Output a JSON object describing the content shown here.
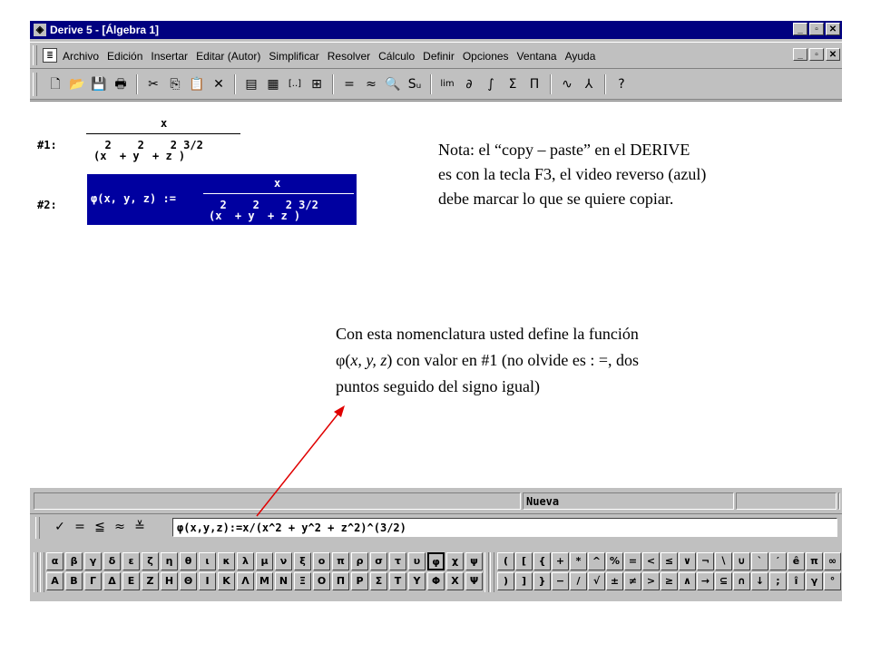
{
  "window": {
    "title": "Derive 5 - [Álgebra 1]",
    "app_icon": "◈",
    "buttons": [
      "_",
      "▫",
      "✕"
    ]
  },
  "menu": {
    "doc_icon": "≣",
    "items": [
      "Archivo",
      "Edición",
      "Insertar",
      "Editar (Autor)",
      "Simplificar",
      "Resolver",
      "Cálculo",
      "Definir",
      "Opciones",
      "Ventana",
      "Ayuda"
    ],
    "mdi_buttons": [
      "_",
      "▫",
      "✕"
    ]
  },
  "toolbar": {
    "icons": [
      {
        "name": "new-doc-icon",
        "glyph": "🗋"
      },
      {
        "name": "open-folder-icon",
        "glyph": "📂"
      },
      {
        "name": "save-icon",
        "glyph": "💾"
      },
      {
        "name": "print-icon",
        "glyph": "🖶"
      },
      {
        "name": "sep"
      },
      {
        "name": "cut-icon",
        "glyph": "✂"
      },
      {
        "name": "copy-icon",
        "glyph": "⎘"
      },
      {
        "name": "paste-icon",
        "glyph": "📋"
      },
      {
        "name": "delete-icon",
        "glyph": "✕"
      },
      {
        "name": "sep"
      },
      {
        "name": "text-object-icon",
        "glyph": "▤"
      },
      {
        "name": "edit-object-icon",
        "glyph": "▦"
      },
      {
        "name": "vector-icon",
        "glyph": "[..]"
      },
      {
        "name": "matrix-icon",
        "glyph": "⊞"
      },
      {
        "name": "sep"
      },
      {
        "name": "simplify-icon",
        "glyph": "="
      },
      {
        "name": "approximate-icon",
        "glyph": "≈"
      },
      {
        "name": "solve-icon",
        "glyph": "🔍"
      },
      {
        "name": "substitute-icon",
        "glyph": "Sᵤ"
      },
      {
        "name": "sep"
      },
      {
        "name": "limit-icon",
        "glyph": "lim"
      },
      {
        "name": "derivative-icon",
        "glyph": "∂"
      },
      {
        "name": "integral-icon",
        "glyph": "∫"
      },
      {
        "name": "sum-icon",
        "glyph": "Σ"
      },
      {
        "name": "product-icon",
        "glyph": "Π"
      },
      {
        "name": "sep"
      },
      {
        "name": "plot-2d-icon",
        "glyph": "∿"
      },
      {
        "name": "plot-3d-icon",
        "glyph": "⅄"
      },
      {
        "name": "sep"
      },
      {
        "name": "help-icon",
        "glyph": "?"
      }
    ]
  },
  "expressions": {
    "label1": "#1:",
    "label2": "#2:",
    "e1_num": "x",
    "e1_exp": "  2    2    2 3/2",
    "e1_den": "(x  + y  + z )",
    "e2_lhs": "φ(x, y, z) :=",
    "e2_num": "x",
    "e2_exp": "  2    2    2 3/2",
    "e2_den": "(x  + y  + z )"
  },
  "notes": {
    "nota_lines": [
      "Nota: el  “copy – paste” en el DERIVE",
      "es con la tecla F3, el video reverso (azul)",
      "debe marcar lo que se quiere copiar."
    ],
    "con_line1": "Con esta nomenclatura usted define la función",
    "con_phi": "φ(",
    "con_vars": "x, y, z",
    "con_rest": ") con valor en #1 (no olvide es : =, dos",
    "con_line3": "puntos seguido del signo igual)"
  },
  "status": {
    "text": "Nueva"
  },
  "input": {
    "buttons": [
      {
        "name": "enter-icon",
        "glyph": "✓"
      },
      {
        "name": "simplify-enter-icon",
        "glyph": "="
      },
      {
        "name": "approx-enter-icon",
        "glyph": "≦"
      },
      {
        "name": "approximate-enter-icon",
        "glyph": "≈"
      },
      {
        "name": "cancel-enter-icon",
        "glyph": "≚"
      }
    ],
    "value": "φ(x,y,z):=x/(x^2 + y^2 + z^2)^(3/2)"
  },
  "greek_lower": [
    "α",
    "β",
    "γ",
    "δ",
    "ε",
    "ζ",
    "η",
    "θ",
    "ι",
    "κ",
    "λ",
    "μ",
    "ν",
    "ξ",
    "ο",
    "π",
    "ρ",
    "σ",
    "τ",
    "υ",
    "φ",
    "χ",
    "ψ"
  ],
  "greek_upper": [
    "Α",
    "Β",
    "Γ",
    "Δ",
    "Ε",
    "Ζ",
    "Η",
    "Θ",
    "Ι",
    "Κ",
    "Λ",
    "Μ",
    "Ν",
    "Ξ",
    "Ο",
    "Π",
    "Ρ",
    "Σ",
    "Τ",
    "Υ",
    "Φ",
    "Χ",
    "Ψ"
  ],
  "symbols_row1": [
    "(",
    "[",
    "{",
    "+",
    "*",
    "^",
    "%",
    "=",
    "<",
    "≤",
    "∨",
    "¬",
    "∖",
    "∪",
    "`",
    "′",
    "ê",
    "π",
    "∞"
  ],
  "symbols_row2": [
    ")",
    "]",
    "}",
    "−",
    "/",
    "√",
    "±",
    "≠",
    ">",
    "≥",
    "∧",
    "→",
    "⊆",
    "∩",
    "↓",
    ";",
    "î",
    "γ",
    "°"
  ]
}
